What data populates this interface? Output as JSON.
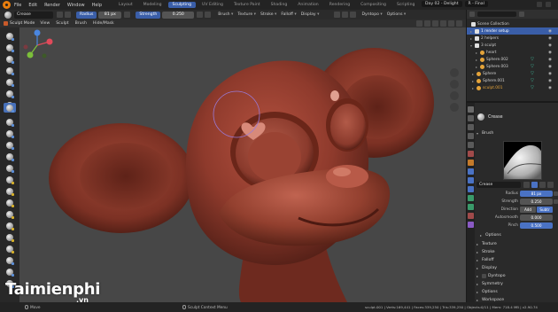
{
  "menubar": {
    "items": [
      "File",
      "Edit",
      "Render",
      "Window",
      "Help"
    ],
    "workspace_tabs": [
      "Layout",
      "Modeling",
      "Sculpting",
      "UV Editing",
      "Texture Paint",
      "Shading",
      "Animation",
      "Rendering",
      "Compositing",
      "Scripting"
    ],
    "active_workspace": "Sculpting",
    "scene_name": "Day 02 - Delight",
    "view_layer": "R - Final"
  },
  "tool_header": {
    "brush_name": "Crease",
    "radius_label": "Radius",
    "radius_value": "81 px",
    "strength_label": "Strength",
    "strength_value": "0.250",
    "dropdowns": [
      "Brush",
      "Texture",
      "Stroke",
      "Falloff",
      "Display"
    ]
  },
  "sub_header": {
    "mode": "Sculpt Mode",
    "menus": [
      "View",
      "Sculpt",
      "Brush",
      "Hide/Mask"
    ]
  },
  "header_right": {
    "dyntopo_label": "Dyntopo",
    "options_label": "Options"
  },
  "outliner": {
    "title": "Scene Collection",
    "rows": [
      {
        "label": "1 render setup",
        "selected": true
      },
      {
        "label": "2 helpers",
        "selected": false
      },
      {
        "label": "3 sculpt",
        "selected": false
      },
      {
        "label": "heart",
        "selected": false
      },
      {
        "label": "Sphere.002",
        "selected": false
      },
      {
        "label": "Sphere.003",
        "selected": false
      },
      {
        "label": "Sphere",
        "selected": false
      },
      {
        "label": "Sphere.001",
        "selected": false
      },
      {
        "label": "sculpt.001",
        "selected": false
      }
    ]
  },
  "properties": {
    "tool_name": "Crease",
    "brush_section": "Brush",
    "brush_name": "Crease",
    "rows": [
      {
        "label": "Radius",
        "value": "81 px"
      },
      {
        "label": "Strength",
        "value": "0.250"
      },
      {
        "label": "Direction",
        "value_a": "Add",
        "value_b": "Subtr"
      },
      {
        "label": "Autosmooth",
        "value": "0.000"
      },
      {
        "label": "Pinch",
        "value": "0.500"
      }
    ],
    "options_label": "Options",
    "sections": [
      "Texture",
      "Stroke",
      "Falloff",
      "Display",
      "Dyntopo",
      "Symmetry",
      "Options",
      "Workspace"
    ]
  },
  "status_bar": {
    "left_action": "Move",
    "mid_action": "Sculpt Context Menu",
    "stats": "sculpt.001 | Verts:169,441 | Faces:339,250 | Tris:339,250 | Objects:0/11 | Mem: 718.4 MB | v2.90.74"
  },
  "watermark": {
    "brand": "Taimienphi",
    "suffix": ".vn"
  },
  "colors": {
    "accent": "#3a5ea8",
    "model": "#8e3a2c",
    "viewport_bg": "#474747"
  }
}
